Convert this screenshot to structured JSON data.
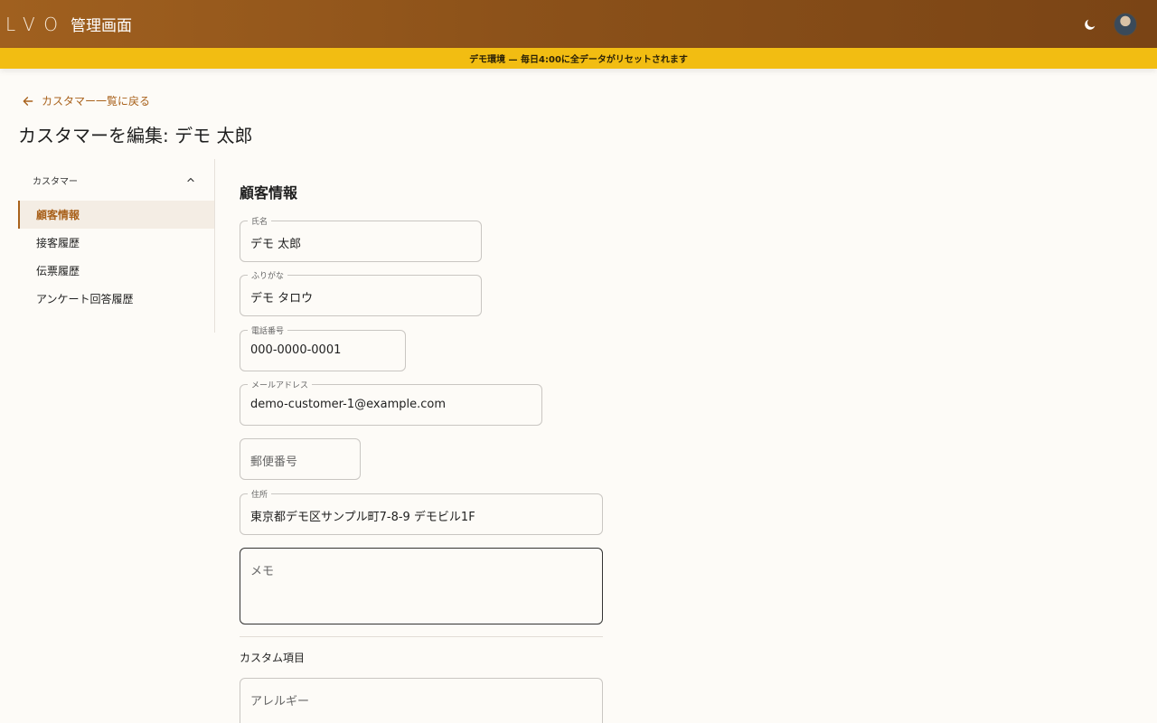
{
  "app": {
    "logo": "LVO",
    "title": "管理画面"
  },
  "banner": {
    "text": "デモ環境 — 毎日4:00に全データがリセットされます"
  },
  "nav": {
    "back_label": "カスタマー一覧に戻る",
    "page_title": "カスタマーを編集: デモ 太郎"
  },
  "sidebar": {
    "group_label": "カスタマー",
    "items": [
      {
        "label": "顧客情報",
        "active": true
      },
      {
        "label": "接客履歴",
        "active": false
      },
      {
        "label": "伝票履歴",
        "active": false
      },
      {
        "label": "アンケート回答履歴",
        "active": false
      }
    ]
  },
  "form": {
    "section_title": "顧客情報",
    "name": {
      "label": "氏名",
      "value": "デモ 太郎"
    },
    "kana": {
      "label": "ふりがな",
      "value": "デモ タロウ"
    },
    "phone": {
      "label": "電話番号",
      "value": "000-0000-0001"
    },
    "email": {
      "label": "メールアドレス",
      "value": "demo-customer-1@example.com"
    },
    "postal": {
      "placeholder": "郵便番号"
    },
    "address": {
      "label": "住所",
      "value": "東京都デモ区サンプル町7-8-9 デモビル1F"
    },
    "memo": {
      "placeholder": "メモ"
    },
    "custom_section_title": "カスタム項目",
    "allergy": {
      "placeholder": "アレルギー"
    }
  },
  "colors": {
    "accent": "#a9621c",
    "banner": "#f2bd12",
    "appbar": "#8a5019"
  },
  "icons": {
    "theme_toggle": "moon-icon",
    "back": "arrow-left-icon",
    "collapse": "chevron-up-icon"
  }
}
